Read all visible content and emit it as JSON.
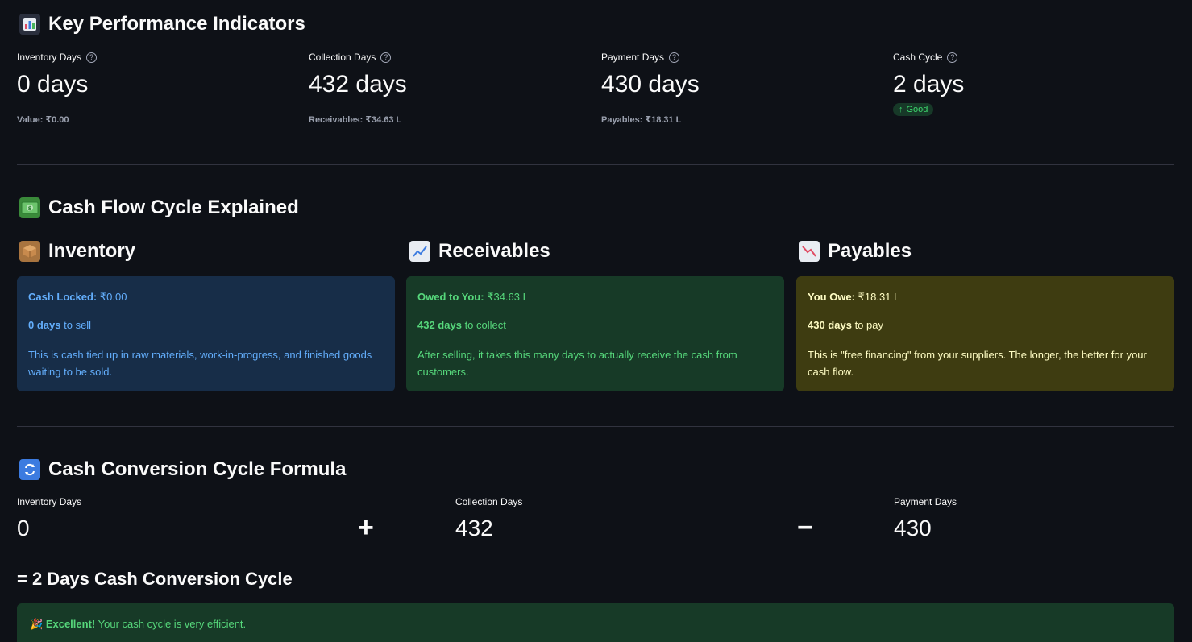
{
  "kpi": {
    "title": "Key Performance Indicators",
    "icon": "bar-chart-icon",
    "items": [
      {
        "label": "Inventory Days",
        "value": "0 days",
        "sub": "Value: ₹0.00"
      },
      {
        "label": "Collection Days",
        "value": "432 days",
        "sub": "Receivables: ₹34.63 L"
      },
      {
        "label": "Payment Days",
        "value": "430 days",
        "sub": "Payables: ₹18.31 L"
      },
      {
        "label": "Cash Cycle",
        "value": "2 days",
        "badge": "Good"
      }
    ]
  },
  "cashflow": {
    "title": "Cash Flow Cycle Explained",
    "icon": "money-icon",
    "inventory": {
      "title": "Inventory",
      "icon": "package-icon",
      "line1_label": "Cash Locked:",
      "line1_value": "₹0.00",
      "line2_strong": "0 days",
      "line2_rest": "to sell",
      "desc": "This is cash tied up in raw materials, work-in-progress, and finished goods waiting to be sold."
    },
    "receivables": {
      "title": "Receivables",
      "icon": "chart-up-icon",
      "line1_label": "Owed to You:",
      "line1_value": "₹34.63 L",
      "line2_strong": "432 days",
      "line2_rest": "to collect",
      "desc": "After selling, it takes this many days to actually receive the cash from customers."
    },
    "payables": {
      "title": "Payables",
      "icon": "chart-down-icon",
      "line1_label": "You Owe:",
      "line1_value": "₹18.31 L",
      "line2_strong": "430 days",
      "line2_rest": "to pay",
      "desc": "This is \"free financing\" from your suppliers. The longer, the better for your cash flow."
    }
  },
  "formula": {
    "title": "Cash Conversion Cycle Formula",
    "icon": "cycle-icon",
    "inventory_label": "Inventory Days",
    "inventory_value": "0",
    "plus": "+",
    "collection_label": "Collection Days",
    "collection_value": "432",
    "minus": "−",
    "payment_label": "Payment Days",
    "payment_value": "430",
    "result": "= 2 Days Cash Conversion Cycle"
  },
  "success": {
    "icon": "party-icon",
    "strong": "Excellent!",
    "text": "Your cash cycle is very efficient."
  },
  "colors": {
    "background": "#0e1117",
    "blue_card": "#172d48",
    "green_card": "#173a27",
    "yellow_card": "#3e3c11"
  }
}
